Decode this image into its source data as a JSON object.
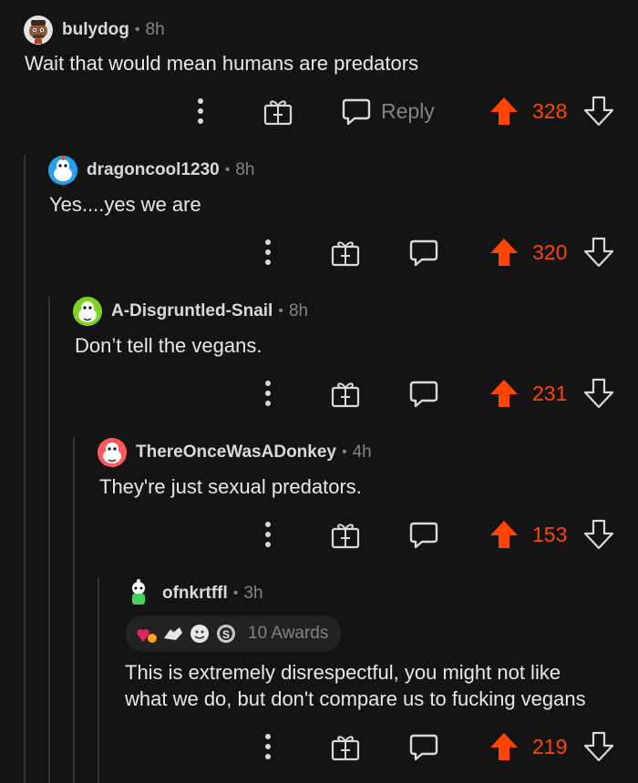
{
  "comments": [
    {
      "username": "bulydog",
      "time": "8h",
      "text": "Wait that would mean humans are predators",
      "reply_label": "Reply",
      "votes": "328"
    },
    {
      "username": "dragoncool1230",
      "time": "8h",
      "text": "Yes....yes we are",
      "votes": "320"
    },
    {
      "username": "A-Disgruntled-Snail",
      "time": "8h",
      "text": "Don’t tell the vegans.",
      "votes": "231"
    },
    {
      "username": "ThereOnceWasADonkey",
      "time": "4h",
      "text": "They're just sexual predators.",
      "votes": "153"
    },
    {
      "username": "ofnkrtffl",
      "time": "3h",
      "awards_label": "10 Awards",
      "text_line1": "This is extremely disrespectful, you might not like",
      "text_line2": "what we do, but don't compare us to fucking vegans",
      "votes": "219"
    }
  ],
  "separator": "•",
  "colors": {
    "background": "#141414",
    "upvote": "#ff4500",
    "muted": "#818384",
    "thread_line": "#343536"
  },
  "icons": [
    "more-options-icon",
    "gift-award-icon",
    "reply-bubble-icon",
    "upvote-arrow-icon",
    "downvote-arrow-icon"
  ]
}
